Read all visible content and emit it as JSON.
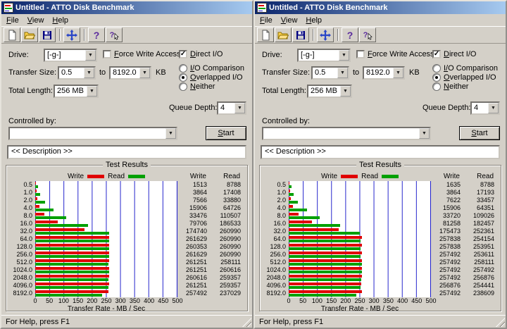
{
  "app": {
    "title": "Untitled - ATTO Disk Benchmark",
    "menu": [
      "File",
      "View",
      "Help"
    ],
    "status": "For Help, press F1"
  },
  "toolbar": {
    "buttons": [
      "new-file",
      "open-folder",
      "save",
      "separator",
      "move-tool",
      "separator",
      "help",
      "context-help"
    ]
  },
  "labels": {
    "drive": "Drive:",
    "force_write_access": "Force Write Access",
    "direct_io": "Direct I/O",
    "transfer_size": "Transfer Size:",
    "to": "to",
    "kb": "KB",
    "io_comparison": "I/O Comparison",
    "overlapped_io": "Overlapped I/O",
    "neither": "Neither",
    "total_length": "Total Length:",
    "queue_depth": "Queue Depth:",
    "controlled_by": "Controlled by:",
    "start": "Start",
    "test_results": "Test Results",
    "write": "Write",
    "read": "Read",
    "transfer_rate": "Transfer Rate - MB / Sec"
  },
  "controls": {
    "drive_value": "[-g-]",
    "force_write_checked": false,
    "direct_io_checked": true,
    "transfer_from": "0.5",
    "transfer_to": "8192.0",
    "io_comparison_selected": false,
    "overlapped_io_selected": true,
    "neither_selected": false,
    "total_length_value": "256 MB",
    "queue_depth_value": "4",
    "controlled_by_value": ""
  },
  "description": {
    "text": "<< Description >>"
  },
  "icons": {
    "checkmark": "✓",
    "dropdown_arrow": "▼"
  },
  "colors": {
    "write": "#e00000",
    "read": "#00a000",
    "grid": "#2222cc"
  },
  "chart_data": [
    {
      "id": "left",
      "type": "bar",
      "orientation": "horizontal",
      "title": "Test Results",
      "xlabel": "Transfer Rate - MB / Sec",
      "xlim": [
        0,
        500
      ],
      "xticks": [
        0,
        50,
        100,
        150,
        200,
        250,
        300,
        350,
        400,
        450,
        500
      ],
      "grid": true,
      "legend_position": "top",
      "categories": [
        "0.5",
        "1.0",
        "2.0",
        "4.0",
        "8.0",
        "16.0",
        "32.0",
        "64.0",
        "128.0",
        "256.0",
        "512.0",
        "1024.0",
        "2048.0",
        "4096.0",
        "8192.0"
      ],
      "series": [
        {
          "name": "Write",
          "color": "#e00000",
          "values": [
            1513,
            3864,
            7566,
            15906,
            33476,
            79706,
            174740,
            261629,
            260353,
            261629,
            261251,
            261251,
            260616,
            261251,
            257492
          ]
        },
        {
          "name": "Read",
          "color": "#00a000",
          "values": [
            8788,
            17408,
            33880,
            64726,
            110507,
            186533,
            260990,
            260990,
            260990,
            260990,
            258111,
            260616,
            259357,
            259357,
            237029
          ]
        }
      ]
    },
    {
      "id": "right",
      "type": "bar",
      "orientation": "horizontal",
      "title": "Test Results",
      "xlabel": "Transfer Rate - MB / Sec",
      "xlim": [
        0,
        500
      ],
      "xticks": [
        0,
        50,
        100,
        150,
        200,
        250,
        300,
        350,
        400,
        450,
        500
      ],
      "grid": true,
      "legend_position": "top",
      "categories": [
        "0.5",
        "1.0",
        "2.0",
        "4.0",
        "8.0",
        "16.0",
        "32.0",
        "64.0",
        "128.0",
        "256.0",
        "512.0",
        "1024.0",
        "2048.0",
        "4096.0",
        "8192.0"
      ],
      "series": [
        {
          "name": "Write",
          "color": "#e00000",
          "values": [
            1635,
            3864,
            7622,
            15906,
            33720,
            81258,
            175473,
            257838,
            257838,
            257492,
            257492,
            257492,
            257492,
            256876,
            257492
          ]
        },
        {
          "name": "Read",
          "color": "#00a000",
          "values": [
            8788,
            17193,
            33457,
            64351,
            109026,
            182457,
            252361,
            254154,
            253951,
            253611,
            258111,
            257492,
            256876,
            254441,
            238609
          ]
        }
      ]
    }
  ]
}
